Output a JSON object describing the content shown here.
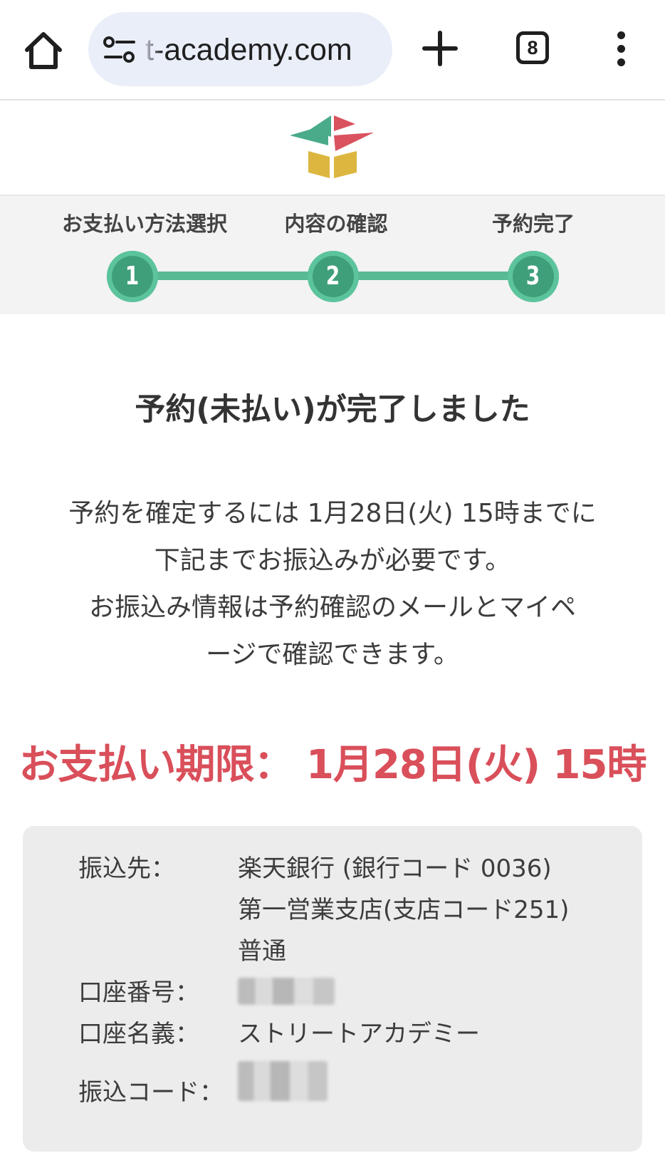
{
  "browser": {
    "url": "t-academy.com",
    "tab_count": "8",
    "icons": [
      "home-icon",
      "site-settings-icon",
      "new-tab-icon",
      "tab-switcher-icon",
      "more-menu-icon"
    ]
  },
  "site": {
    "logo_colors": [
      "#4aab8a",
      "#d9525e",
      "#dcb63f"
    ]
  },
  "steps": {
    "items": [
      {
        "label": "お支払い方法選択",
        "number": "1"
      },
      {
        "label": "内容の確認",
        "number": "2"
      },
      {
        "label": "予約完了",
        "number": "3"
      }
    ],
    "accent_color": "#58b995"
  },
  "main": {
    "heading": "予約(未払い)が完了しました",
    "message_lines": [
      "予約を確定するには 1月28日(火) 15時までに",
      "下記までお振込みが必要です。",
      "お振込み情報は予約確認のメールとマイペ",
      "ージで確認できます。"
    ],
    "deadline": "お支払い期限： 1月28日(火) 15時",
    "deadline_color": "#d94f5a"
  },
  "transfer": {
    "bank_label": "振込先：",
    "bank_lines": [
      "楽天銀行 (銀行コード 0036)",
      "第一営業支店(支店コード251)",
      "普通"
    ],
    "account_number_label": "口座番号：",
    "account_holder_label": "口座名義：",
    "account_holder": "ストリートアカデミー",
    "transfer_code_label": "振込コード："
  }
}
